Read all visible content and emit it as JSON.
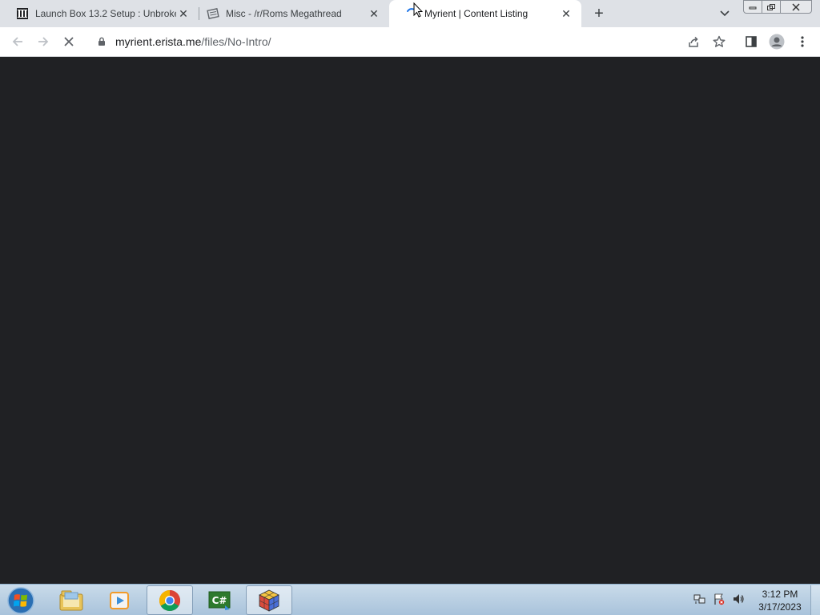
{
  "browser": {
    "tabs": [
      {
        "title": "Launch Box 13.2 Setup : Unbroke",
        "favicon": "columns-icon",
        "active": false
      },
      {
        "title": "Misc - /r/Roms Megathread",
        "favicon": "page-icon",
        "active": false
      },
      {
        "title": "Myrient | Content Listing",
        "favicon": "loading-spinner-icon",
        "active": true
      }
    ],
    "new_tab": "+",
    "url_host": "myrient.erista.me",
    "url_path": "/files/No-Intro/"
  },
  "taskbar": {
    "time": "3:12 PM",
    "date": "3/17/2023",
    "apps": [
      "explorer-icon",
      "media-player-icon",
      "chrome-icon",
      "csharp-icon",
      "cube-app-icon"
    ]
  },
  "colors": {
    "content_bg": "#202124",
    "tabstrip_bg": "#dee1e6",
    "accent": "#1a73e8"
  }
}
